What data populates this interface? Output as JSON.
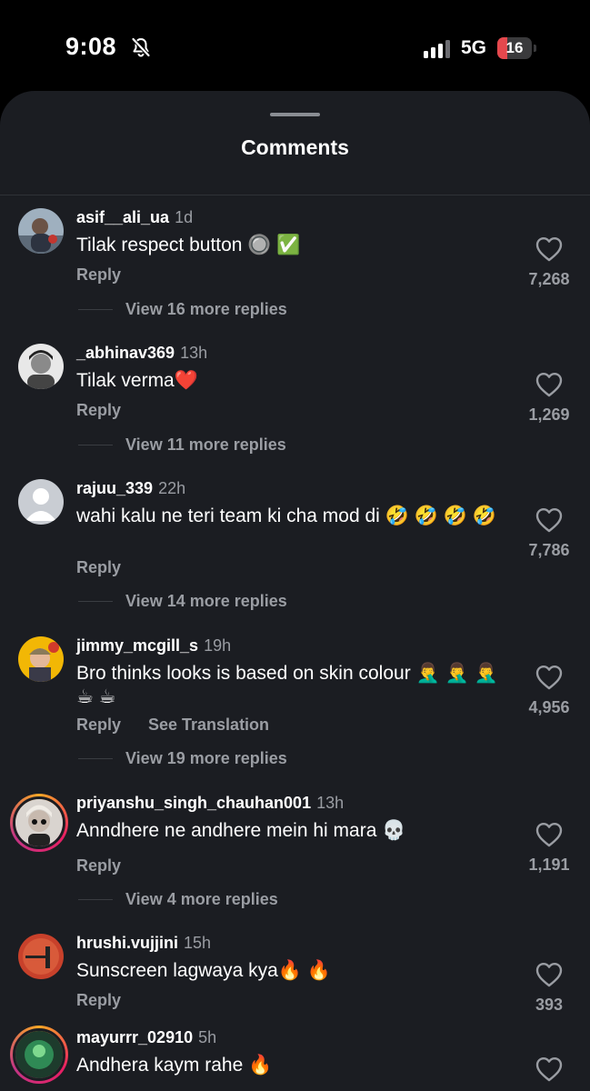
{
  "status_bar": {
    "time": "9:08",
    "network": "5G",
    "battery": "16",
    "battery_level": 0.16
  },
  "sheet": {
    "title": "Comments"
  },
  "comments": [
    {
      "username": "asif__ali_ua",
      "time": "1d",
      "text": "Tilak respect button 🔘 ✅",
      "reply": "Reply",
      "view_replies": "View 16 more replies",
      "likes": "7,268"
    },
    {
      "username": "_abhinav369",
      "time": "13h",
      "text": "Tilak verma❤️",
      "reply": "Reply",
      "view_replies": "View 11 more replies",
      "likes": "1,269"
    },
    {
      "username": "rajuu_339",
      "time": "22h",
      "text": "wahi kalu ne teri team ki cha mod di 🤣 🤣 🤣 🤣",
      "reply": "Reply",
      "view_replies": "View 14 more replies",
      "likes": "7,786"
    },
    {
      "username": "jimmy_mcgill_s",
      "time": "19h",
      "text": "Bro thinks looks is based on skin colour 🤦‍♂️ 🤦‍♂️ 🤦‍♂️ ☕ ☕",
      "reply": "Reply",
      "translate": "See Translation",
      "view_replies": "View 19 more replies",
      "likes": "4,956"
    },
    {
      "username": "priyanshu_singh_chauhan001",
      "time": "13h",
      "text": "Anndhere ne andhere mein hi mara 💀",
      "reply": "Reply",
      "view_replies": "View 4 more replies",
      "likes": "1,191"
    },
    {
      "username": "hrushi.vujjini",
      "time": "15h",
      "text": "Sunscreen lagwaya kya🔥 🔥",
      "reply": "Reply",
      "likes": "393"
    },
    {
      "username": "mayurrr_02910",
      "time": "5h",
      "text": "Andhera kaym rahe 🔥"
    }
  ],
  "icons": {
    "like": "heart-outline-icon",
    "mute": "bell-slash-icon",
    "signal": "cellular-signal-icon"
  },
  "colors": {
    "background": "#1b1d22",
    "muted_text": "#9a9da3",
    "battery_low": "#e5484d"
  }
}
